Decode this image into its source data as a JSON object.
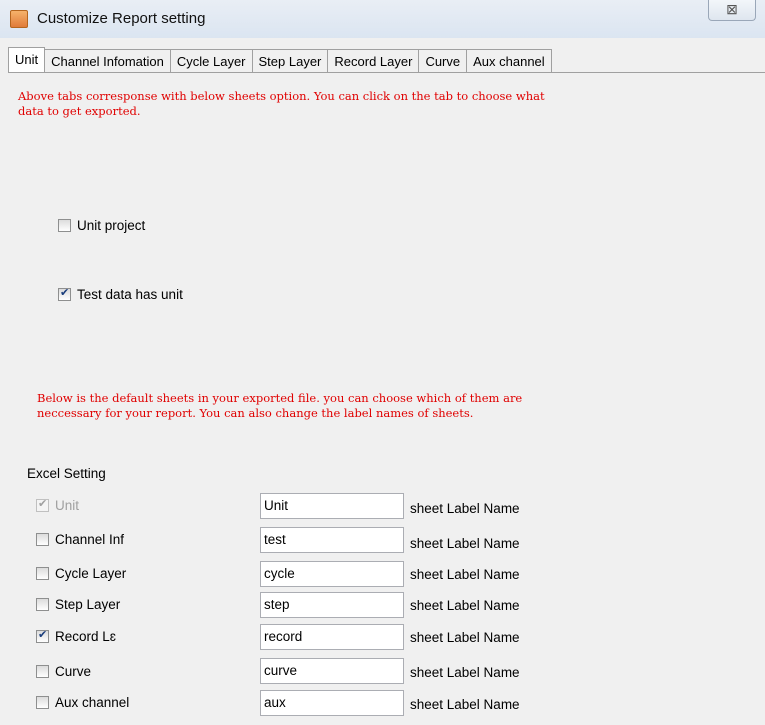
{
  "window": {
    "title": "Customize Report setting",
    "close_glyph": "⊠"
  },
  "tabs": [
    "Unit",
    "Channel Infomation",
    "Cycle Layer",
    "Step Layer",
    "Record Layer",
    "Curve",
    "Aux channel"
  ],
  "instructions_top": "Above tabs corresponse with below sheets option. You can click on the tab to choose what\ndata to get exported.",
  "options": {
    "unit_project": {
      "label": "Unit project",
      "checked": false
    },
    "test_data_has_unit": {
      "label": "Test data has unit",
      "checked": true
    }
  },
  "instructions_bottom": "Below is the default sheets in your exported file. you can choose which of them are\nneccessary for your report. You can also change the label names of sheets.",
  "excel": {
    "section_label": "Excel Setting",
    "sheet_label_text": "sheet Label Name",
    "rows": [
      {
        "label": "Unit",
        "value": "Unit",
        "checked": true,
        "disabled": true
      },
      {
        "label": "Channel Inf",
        "value": "test",
        "checked": false,
        "disabled": false
      },
      {
        "label": "Cycle Layer",
        "value": "cycle",
        "checked": false,
        "disabled": false
      },
      {
        "label": "Step Layer",
        "value": "step",
        "checked": false,
        "disabled": false
      },
      {
        "label": "Record Lɛ",
        "value": "record",
        "checked": true,
        "disabled": false
      },
      {
        "label": "Curve",
        "value": "curve",
        "checked": false,
        "disabled": false
      },
      {
        "label": "Aux channel",
        "value": "aux",
        "checked": false,
        "disabled": false
      }
    ]
  }
}
